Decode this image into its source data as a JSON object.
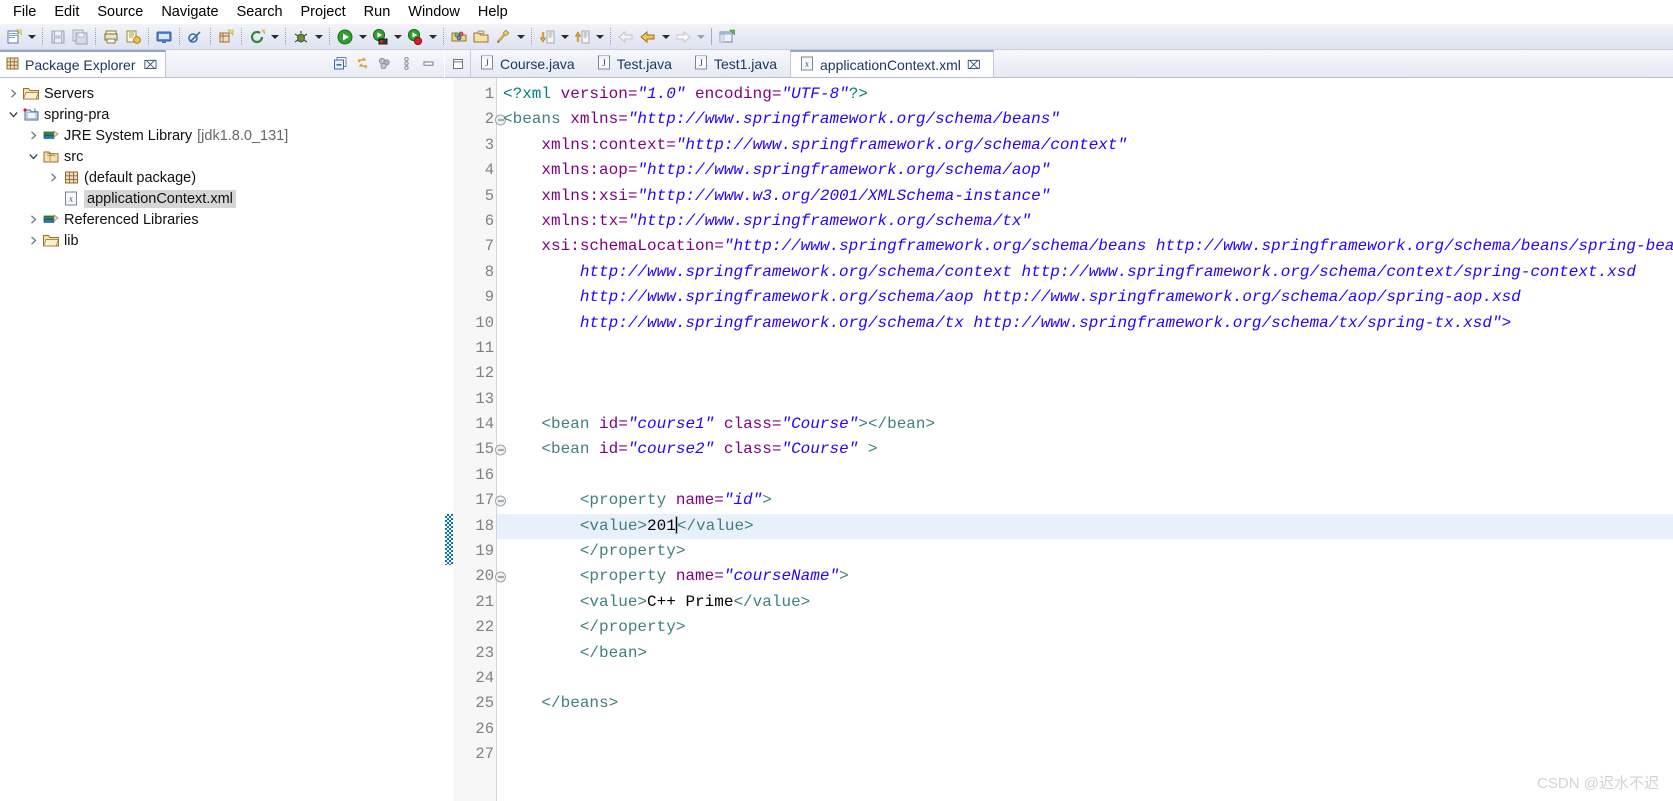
{
  "menubar": {
    "items": [
      {
        "label": "File"
      },
      {
        "label": "Edit"
      },
      {
        "label": "Source"
      },
      {
        "label": "Navigate"
      },
      {
        "label": "Search"
      },
      {
        "label": "Project"
      },
      {
        "label": "Run"
      },
      {
        "label": "Window"
      },
      {
        "label": "Help"
      }
    ]
  },
  "toolbar": {
    "groups": [
      {
        "icons": [
          "new-wizard-icon",
          "dropdown-arrow"
        ]
      },
      {
        "icons": [
          "save-icon",
          "save-all-icon"
        ]
      },
      {
        "icons": [
          "print-icon",
          "build-all-icon"
        ]
      },
      {
        "icons": [
          "console-icon"
        ]
      },
      {
        "icons": [
          "skip-breakpoints-icon"
        ]
      },
      {
        "icons": [
          "new-package-icon"
        ]
      },
      {
        "icons": [
          "last-edit-icon",
          "dropdown-arrow"
        ]
      },
      {
        "icons": [
          "debug-icon",
          "dropdown-arrow"
        ]
      },
      {
        "icons": [
          "run-icon",
          "dropdown-arrow"
        ]
      },
      {
        "icons": [
          "run-server-icon",
          "dropdown-arrow"
        ]
      },
      {
        "icons": [
          "stop-server-icon",
          "dropdown-arrow"
        ]
      },
      {
        "icons": [
          "open-type-icon",
          "open-folder-icon",
          "search-icon",
          "dropdown-arrow"
        ]
      },
      {
        "icons": [
          "next-annotation-icon",
          "dropdown-arrow",
          "previous-annotation-icon",
          "dropdown-arrow"
        ]
      },
      {
        "icons": [
          "back-disabled-icon",
          "back-icon",
          "dropdown-arrow",
          "forward-icon",
          "dropdown-arrow"
        ]
      },
      {
        "icons": [
          "open-perspective-icon"
        ]
      }
    ]
  },
  "explorer": {
    "tab_title": "Package Explorer",
    "tab_icon": "package-explorer-icon",
    "close_glyph": "⌧",
    "toolbar_icons": [
      "collapse-all-icon",
      "link-with-editor-icon",
      "view-menu-icon",
      "view-options-icon",
      "minimize-icon"
    ],
    "tree": [
      {
        "label": "Servers",
        "detail": "",
        "icon": "folder-icon",
        "indent": 0,
        "twisty": "collapsed",
        "selected": false
      },
      {
        "label": "spring-pra",
        "detail": "",
        "icon": "project-icon",
        "indent": 0,
        "twisty": "expanded",
        "selected": false
      },
      {
        "label": "JRE System Library",
        "detail": "[jdk1.8.0_131]",
        "icon": "library-icon",
        "indent": 1,
        "twisty": "collapsed",
        "selected": false
      },
      {
        "label": "src",
        "detail": "",
        "icon": "source-folder-icon",
        "indent": 1,
        "twisty": "expanded",
        "selected": false
      },
      {
        "label": "(default package)",
        "detail": "",
        "icon": "package-icon",
        "indent": 2,
        "twisty": "collapsed",
        "selected": false
      },
      {
        "label": "applicationContext.xml",
        "detail": "",
        "icon": "xml-file-icon",
        "indent": 2,
        "twisty": "none",
        "selected": true
      },
      {
        "label": "Referenced Libraries",
        "detail": "",
        "icon": "library-icon",
        "indent": 1,
        "twisty": "collapsed",
        "selected": false
      },
      {
        "label": "lib",
        "detail": "",
        "icon": "folder-icon",
        "indent": 1,
        "twisty": "collapsed",
        "selected": false
      }
    ]
  },
  "editor": {
    "minimize_icon": "restore-icon",
    "tabs": [
      {
        "label": "Course.java",
        "icon": "java-file-icon",
        "active": false,
        "close": ""
      },
      {
        "label": "Test.java",
        "icon": "java-file-icon",
        "active": false,
        "close": ""
      },
      {
        "label": "Test1.java",
        "icon": "java-file-icon",
        "active": false,
        "close": ""
      },
      {
        "label": "applicationContext.xml",
        "icon": "xml-file-icon",
        "active": true,
        "close": "⌧"
      }
    ],
    "highlighted_line": 18,
    "change_marker_lines": [
      18,
      19
    ],
    "folding_lines": [
      2,
      15,
      17,
      20
    ],
    "lines": [
      {
        "n": 1,
        "tokens": [
          {
            "t": "<?xml ",
            "c": "punc"
          },
          {
            "t": "version=",
            "c": "attr"
          },
          {
            "t": "\"1.0\"",
            "c": "str"
          },
          {
            "t": " ",
            "c": "text"
          },
          {
            "t": "encoding=",
            "c": "attr"
          },
          {
            "t": "\"UTF-8\"",
            "c": "str"
          },
          {
            "t": "?>",
            "c": "punc"
          }
        ]
      },
      {
        "n": 2,
        "tokens": [
          {
            "t": "<beans ",
            "c": "tag"
          },
          {
            "t": "xmlns=",
            "c": "attr"
          },
          {
            "t": "\"http://www.springframework.org/schema/beans\"",
            "c": "str"
          }
        ]
      },
      {
        "n": 3,
        "tokens": [
          {
            "t": "    ",
            "c": "text"
          },
          {
            "t": "xmlns:context=",
            "c": "attr"
          },
          {
            "t": "\"http://www.springframework.org/schema/context\"",
            "c": "str"
          }
        ]
      },
      {
        "n": 4,
        "tokens": [
          {
            "t": "    ",
            "c": "text"
          },
          {
            "t": "xmlns:aop=",
            "c": "attr"
          },
          {
            "t": "\"http://www.springframework.org/schema/aop\"",
            "c": "str"
          }
        ]
      },
      {
        "n": 5,
        "tokens": [
          {
            "t": "    ",
            "c": "text"
          },
          {
            "t": "xmlns:xsi=",
            "c": "attr"
          },
          {
            "t": "\"http://www.w3.org/2001/XMLSchema-instance\"",
            "c": "str"
          }
        ]
      },
      {
        "n": 6,
        "tokens": [
          {
            "t": "    ",
            "c": "text"
          },
          {
            "t": "xmlns:tx=",
            "c": "attr"
          },
          {
            "t": "\"http://www.springframework.org/schema/tx\"",
            "c": "str"
          }
        ]
      },
      {
        "n": 7,
        "tokens": [
          {
            "t": "    ",
            "c": "text"
          },
          {
            "t": "xsi:schemaLocation=",
            "c": "attr"
          },
          {
            "t": "\"http://www.springframework.org/schema/beans http://www.springframework.org/schema/beans/spring-beans.xsd",
            "c": "str"
          }
        ]
      },
      {
        "n": 8,
        "tokens": [
          {
            "t": "        ",
            "c": "text"
          },
          {
            "t": "http://www.springframework.org/schema/context http://www.springframework.org/schema/context/spring-context.xsd",
            "c": "str"
          }
        ]
      },
      {
        "n": 9,
        "tokens": [
          {
            "t": "        ",
            "c": "text"
          },
          {
            "t": "http://www.springframework.org/schema/aop http://www.springframework.org/schema/aop/spring-aop.xsd",
            "c": "str"
          }
        ]
      },
      {
        "n": 10,
        "tokens": [
          {
            "t": "        ",
            "c": "text"
          },
          {
            "t": "http://www.springframework.org/schema/tx http://www.springframework.org/schema/tx/spring-tx.xsd\">",
            "c": "str"
          }
        ]
      },
      {
        "n": 11,
        "tokens": []
      },
      {
        "n": 12,
        "tokens": []
      },
      {
        "n": 13,
        "tokens": []
      },
      {
        "n": 14,
        "tokens": [
          {
            "t": "    ",
            "c": "text"
          },
          {
            "t": "<bean ",
            "c": "tag"
          },
          {
            "t": "id=",
            "c": "attr"
          },
          {
            "t": "\"course1\"",
            "c": "str"
          },
          {
            "t": " ",
            "c": "text"
          },
          {
            "t": "class=",
            "c": "attr"
          },
          {
            "t": "\"Course\"",
            "c": "str"
          },
          {
            "t": "></bean>",
            "c": "tag"
          }
        ]
      },
      {
        "n": 15,
        "tokens": [
          {
            "t": "    ",
            "c": "text"
          },
          {
            "t": "<bean ",
            "c": "tag"
          },
          {
            "t": "id=",
            "c": "attr"
          },
          {
            "t": "\"course2\"",
            "c": "str"
          },
          {
            "t": " ",
            "c": "text"
          },
          {
            "t": "class=",
            "c": "attr"
          },
          {
            "t": "\"Course\"",
            "c": "str"
          },
          {
            "t": " >",
            "c": "tag"
          }
        ]
      },
      {
        "n": 16,
        "tokens": []
      },
      {
        "n": 17,
        "tokens": [
          {
            "t": "        ",
            "c": "text"
          },
          {
            "t": "<property ",
            "c": "tag"
          },
          {
            "t": "name=",
            "c": "attr"
          },
          {
            "t": "\"id\"",
            "c": "str"
          },
          {
            "t": ">",
            "c": "tag"
          }
        ]
      },
      {
        "n": 18,
        "tokens": [
          {
            "t": "        ",
            "c": "text"
          },
          {
            "t": "<value>",
            "c": "tag"
          },
          {
            "t": "201",
            "c": "text"
          },
          {
            "t": "CARET",
            "c": "caret"
          },
          {
            "t": "</value>",
            "c": "tag"
          }
        ]
      },
      {
        "n": 19,
        "tokens": [
          {
            "t": "        ",
            "c": "text"
          },
          {
            "t": "</property>",
            "c": "tag"
          }
        ]
      },
      {
        "n": 20,
        "tokens": [
          {
            "t": "        ",
            "c": "text"
          },
          {
            "t": "<property ",
            "c": "tag"
          },
          {
            "t": "name=",
            "c": "attr"
          },
          {
            "t": "\"courseName\"",
            "c": "str"
          },
          {
            "t": ">",
            "c": "tag"
          }
        ]
      },
      {
        "n": 21,
        "tokens": [
          {
            "t": "        ",
            "c": "text"
          },
          {
            "t": "<value>",
            "c": "tag"
          },
          {
            "t": "C++ Prime",
            "c": "text"
          },
          {
            "t": "</value>",
            "c": "tag"
          }
        ]
      },
      {
        "n": 22,
        "tokens": [
          {
            "t": "        ",
            "c": "text"
          },
          {
            "t": "</property>",
            "c": "tag"
          }
        ]
      },
      {
        "n": 23,
        "tokens": [
          {
            "t": "        ",
            "c": "text"
          },
          {
            "t": "</bean>",
            "c": "tag"
          }
        ]
      },
      {
        "n": 24,
        "tokens": []
      },
      {
        "n": 25,
        "tokens": [
          {
            "t": "    ",
            "c": "text"
          },
          {
            "t": "</beans>",
            "c": "tag"
          }
        ]
      },
      {
        "n": 26,
        "tokens": []
      },
      {
        "n": 27,
        "tokens": []
      }
    ]
  },
  "watermark": {
    "text": "CSDN @迟水不迟"
  },
  "colors": {
    "tag": "#3f7f7f",
    "attribute": "#7f007f",
    "string": "#2a00ff",
    "text": "#000000",
    "line_number": "#808080",
    "highlight_row": "#e8f0fb",
    "change_marker": "#0b72b5",
    "toolbar_bg": "#e6e9f4"
  }
}
